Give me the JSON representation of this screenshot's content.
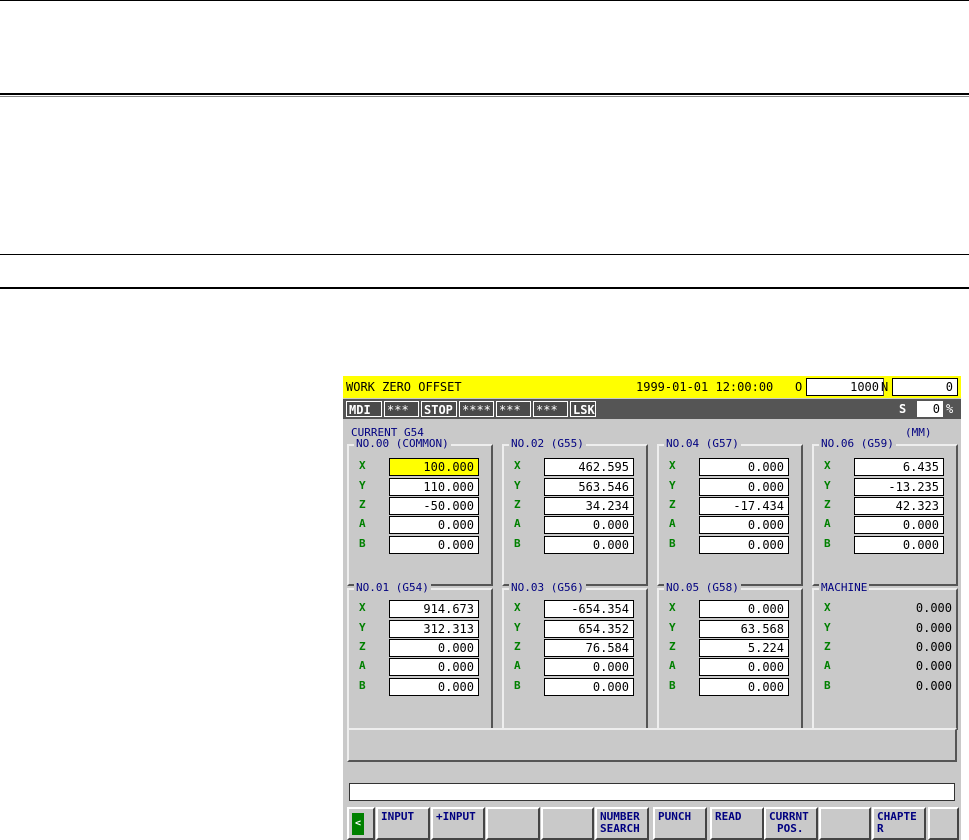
{
  "screen": {
    "title": "WORK ZERO OFFSET",
    "datetime": "1999-01-01 12:00:00",
    "o_label": "O",
    "o_value": "1000",
    "n_label": "N",
    "n_value": "0",
    "status": {
      "mode": "MDI",
      "s1": "***",
      "state": "STOP",
      "s2": "****",
      "s3": "***",
      "s4": "***",
      "lsk": "LSK",
      "s_label": "S",
      "s_value": "0",
      "s_unit": "%"
    },
    "current": "CURRENT G54",
    "unit": "(MM)",
    "panels": [
      {
        "title": "NO.00 (COMMON)",
        "rows": [
          {
            "axis": "X",
            "value": "100.000"
          },
          {
            "axis": "Y",
            "value": "110.000"
          },
          {
            "axis": "Z",
            "value": "-50.000"
          },
          {
            "axis": "A",
            "value": "0.000"
          },
          {
            "axis": "B",
            "value": "0.000"
          }
        ]
      },
      {
        "title": "NO.02 (G55)",
        "rows": [
          {
            "axis": "X",
            "value": "462.595"
          },
          {
            "axis": "Y",
            "value": "563.546"
          },
          {
            "axis": "Z",
            "value": "34.234"
          },
          {
            "axis": "A",
            "value": "0.000"
          },
          {
            "axis": "B",
            "value": "0.000"
          }
        ]
      },
      {
        "title": "NO.04 (G57)",
        "rows": [
          {
            "axis": "X",
            "value": "0.000"
          },
          {
            "axis": "Y",
            "value": "0.000"
          },
          {
            "axis": "Z",
            "value": "-17.434"
          },
          {
            "axis": "A",
            "value": "0.000"
          },
          {
            "axis": "B",
            "value": "0.000"
          }
        ]
      },
      {
        "title": "NO.06 (G59)",
        "rows": [
          {
            "axis": "X",
            "value": "6.435"
          },
          {
            "axis": "Y",
            "value": "-13.235"
          },
          {
            "axis": "Z",
            "value": "42.323"
          },
          {
            "axis": "A",
            "value": "0.000"
          },
          {
            "axis": "B",
            "value": "0.000"
          }
        ]
      },
      {
        "title": "NO.01 (G54)",
        "rows": [
          {
            "axis": "X",
            "value": "914.673"
          },
          {
            "axis": "Y",
            "value": "312.313"
          },
          {
            "axis": "Z",
            "value": "0.000"
          },
          {
            "axis": "A",
            "value": "0.000"
          },
          {
            "axis": "B",
            "value": "0.000"
          }
        ]
      },
      {
        "title": "NO.03 (G56)",
        "rows": [
          {
            "axis": "X",
            "value": "-654.354"
          },
          {
            "axis": "Y",
            "value": "654.352"
          },
          {
            "axis": "Z",
            "value": "76.584"
          },
          {
            "axis": "A",
            "value": "0.000"
          },
          {
            "axis": "B",
            "value": "0.000"
          }
        ]
      },
      {
        "title": "NO.05 (G58)",
        "rows": [
          {
            "axis": "X",
            "value": "0.000"
          },
          {
            "axis": "Y",
            "value": "63.568"
          },
          {
            "axis": "Z",
            "value": "5.224"
          },
          {
            "axis": "A",
            "value": "0.000"
          },
          {
            "axis": "B",
            "value": "0.000"
          }
        ]
      },
      {
        "title": "MACHINE",
        "rows": [
          {
            "axis": "X",
            "value": "0.000"
          },
          {
            "axis": "Y",
            "value": "0.000"
          },
          {
            "axis": "Z",
            "value": "0.000"
          },
          {
            "axis": "A",
            "value": "0.000"
          },
          {
            "axis": "B",
            "value": "0.000"
          }
        ]
      }
    ],
    "softkeys": {
      "left_arrow": "<",
      "k1": "INPUT",
      "k2": "+INPUT",
      "k3": "",
      "k4": "",
      "k5a": "NUMBER",
      "k5b": "SEARCH",
      "k6": "PUNCH",
      "k7": "READ",
      "k8a": "CURRNT",
      "k8b": "POS.",
      "k9": "",
      "k10a": "CHAPTE",
      "k10b": "R",
      "k11": ""
    },
    "colors": {
      "title_bg": "#ffff00",
      "status_bg": "#555555",
      "screen_bg": "#c9c9c9",
      "axis_label": "#008000",
      "panel_title": "#000080"
    }
  }
}
